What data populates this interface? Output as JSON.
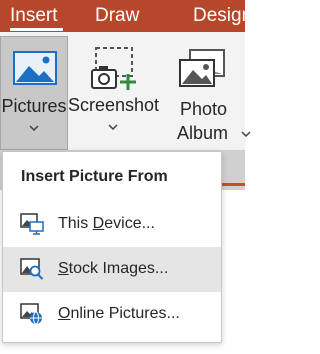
{
  "tabs": {
    "insert": "Insert",
    "draw": "Draw",
    "design": "Design"
  },
  "ribbon": {
    "pictures_label": "Pictures",
    "screenshot_label": "Screenshot",
    "photo_album_line1": "Photo",
    "photo_album_line2": "Album"
  },
  "menu": {
    "header": "Insert Picture From",
    "items": [
      {
        "pre": "This ",
        "key": "D",
        "post": "evice...",
        "icon": "this-device-icon"
      },
      {
        "pre": "",
        "key": "S",
        "post": "tock Images...",
        "icon": "stock-images-icon"
      },
      {
        "pre": "",
        "key": "O",
        "post": "nline Pictures...",
        "icon": "online-pictures-icon"
      }
    ]
  },
  "colors": {
    "ribbon_accent": "#b7472a",
    "menu_hover": "#e5e5e5",
    "icon_blue": "#1e6fc1"
  }
}
